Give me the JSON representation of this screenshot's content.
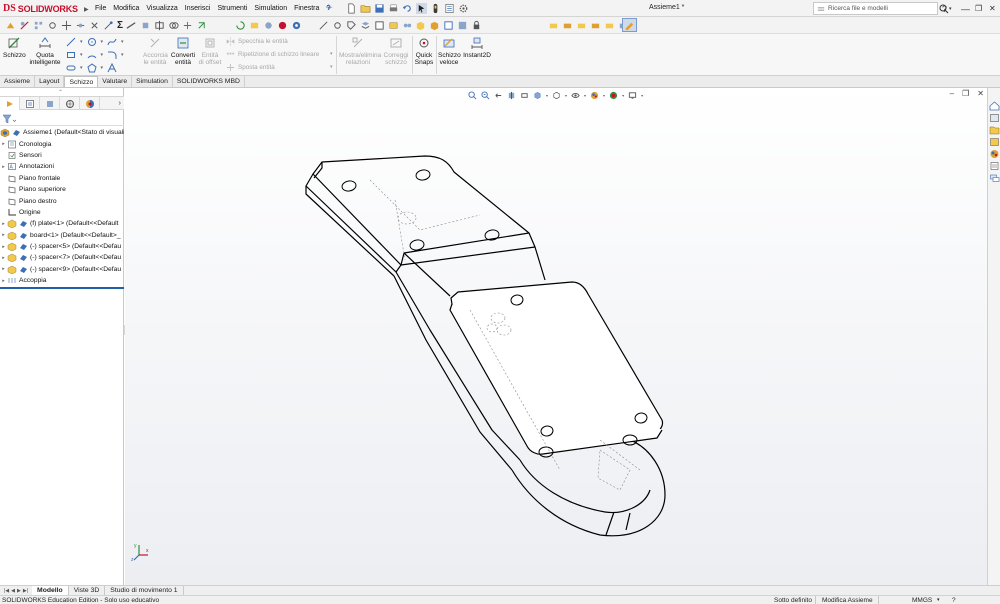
{
  "app": {
    "brand_ds": "DS",
    "brand_name": "SOLIDWORKS",
    "document_title": "Assieme1 *"
  },
  "menu": [
    "File",
    "Modifica",
    "Visualizza",
    "Inserisci",
    "Strumenti",
    "Simulation",
    "Finestra",
    "?"
  ],
  "search": {
    "placeholder": "Ricerca file e modelli"
  },
  "window_controls": {
    "help": "?",
    "minimize": "—",
    "restore": "❐",
    "close": "✕"
  },
  "command_manager": {
    "schizzo": "Schizzo",
    "quota_1": "Quota",
    "quota_2": "intelligente",
    "accorcia_1": "Accorcia",
    "accorcia_2": "le entità",
    "converti_1": "Converti",
    "converti_2": "entità",
    "entita_offset_1": "Entità",
    "entita_offset_2": "di offset",
    "specchia": "Specchia le entità",
    "ripetizione": "Ripetizione di schizzo lineare",
    "sposta": "Sposta entità",
    "mostra_1": "Mostra/elimina",
    "mostra_2": "relazioni",
    "correggi_1": "Correggi",
    "correggi_2": "schizzo",
    "quick_1": "Quick",
    "quick_2": "Snaps",
    "veloce_1": "Schizzo",
    "veloce_2": "veloce",
    "instant": "Instant2D"
  },
  "tabs": [
    "Assieme",
    "Layout",
    "Schizzo",
    "Valutare",
    "Simulation",
    "SOLIDWORKS MBD"
  ],
  "active_tab": "Schizzo",
  "feature_tree": [
    {
      "label": "Assieme1  (Default<Stato di visualiz",
      "icon": "assembly-icon",
      "expand": ""
    },
    {
      "label": "Cronologia",
      "icon": "history-icon",
      "expand": "▸"
    },
    {
      "label": "Sensori",
      "icon": "sensor-icon",
      "expand": ""
    },
    {
      "label": "Annotazioni",
      "icon": "annotation-icon",
      "expand": "▸"
    },
    {
      "label": "Piano frontale",
      "icon": "plane-icon",
      "expand": ""
    },
    {
      "label": "Piano superiore",
      "icon": "plane-icon",
      "expand": ""
    },
    {
      "label": "Piano destro",
      "icon": "plane-icon",
      "expand": ""
    },
    {
      "label": "Origine",
      "icon": "origin-icon",
      "expand": ""
    },
    {
      "label": "(f) plate<1> (Default<<Default",
      "icon": "part-icon",
      "expand": "▸"
    },
    {
      "label": "board<1> (Default<<Default>_",
      "icon": "part-icon",
      "expand": "▸"
    },
    {
      "label": "(-) spacer<5> (Default<<Defau",
      "icon": "part-icon",
      "expand": "▸"
    },
    {
      "label": "(-) spacer<7> (Default<<Defau",
      "icon": "part-icon",
      "expand": "▸"
    },
    {
      "label": "(-) spacer<9> (Default<<Defau",
      "icon": "part-icon",
      "expand": "▸"
    },
    {
      "label": "Accoppia",
      "icon": "mates-icon",
      "expand": "▸"
    }
  ],
  "bottom_tabs": [
    "Modello",
    "Viste 3D",
    "Studio di movimento 1"
  ],
  "active_bottom_tab": "Modello",
  "status": {
    "left": "SOLIDWORKS Education Edition - Solo uso educativo",
    "definition": "Sotto definito",
    "mode": "Modifica Assieme",
    "units": "MMGS"
  },
  "colors": {
    "brand_red": "#c8102e",
    "selection_blue": "#1f5fa8"
  }
}
